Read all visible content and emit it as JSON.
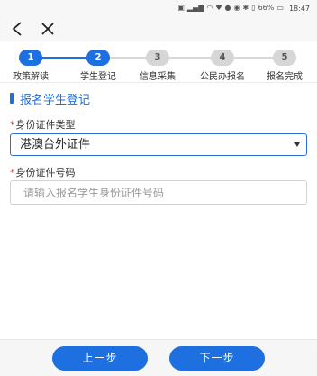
{
  "status_bar": {
    "icons": [
      "hd-icon",
      "signal-icon",
      "wifi-icon",
      "heart-icon",
      "message-icon",
      "eye-icon",
      "bluetooth-icon",
      "vibrate-icon",
      "battery-icon"
    ],
    "battery_text": "66%",
    "time": "18:47"
  },
  "nav": {
    "back_glyph": "<",
    "close_glyph": "✕"
  },
  "stepper": {
    "current_step": 2,
    "steps": [
      {
        "number": "1",
        "label": "政策解读"
      },
      {
        "number": "2",
        "label": "学生登记"
      },
      {
        "number": "3",
        "label": "信息采集"
      },
      {
        "number": "4",
        "label": "公民办报名"
      },
      {
        "number": "5",
        "label": "报名完成"
      }
    ]
  },
  "section": {
    "title": "报名学生登记"
  },
  "form": {
    "required_mark": "*",
    "id_type_label": "身份证件类型",
    "id_type_value": "港澳台外证件",
    "id_number_label": "身份证件号码",
    "id_number_placeholder": "请输入报名学生身份证件号码"
  },
  "footer": {
    "prev_label": "上一步",
    "next_label": "下一步"
  },
  "colors": {
    "accent": "#1e6fe0",
    "required": "#e23b3b"
  }
}
